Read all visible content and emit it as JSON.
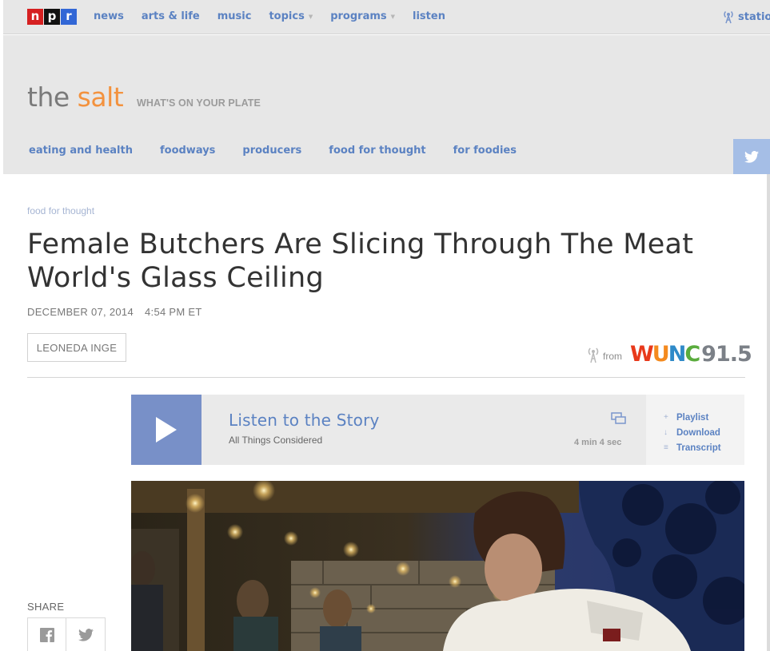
{
  "topnav": {
    "logo_letters": [
      "n",
      "p",
      "r"
    ],
    "links": [
      {
        "label": "news",
        "has_dropdown": false
      },
      {
        "label": "arts & life",
        "has_dropdown": false
      },
      {
        "label": "music",
        "has_dropdown": false
      },
      {
        "label": "topics",
        "has_dropdown": true
      },
      {
        "label": "programs",
        "has_dropdown": true
      },
      {
        "label": "listen",
        "has_dropdown": false
      }
    ],
    "stations_label": "statio",
    "stations_icon": "radio-tower-icon"
  },
  "blog": {
    "name_prefix": "the",
    "name_highlight": "salt",
    "tagline": "WHAT'S ON YOUR PLATE",
    "nav": [
      "eating and health",
      "foodways",
      "producers",
      "food for thought",
      "for foodies"
    ],
    "social_icon": "twitter-icon"
  },
  "article": {
    "slug": "food for thought",
    "title": "Female Butchers Are Slicing Through The Meat World's Glass Ceiling",
    "date": "DECEMBER 07, 2014",
    "time": "4:54 PM ET",
    "author": "LEONEDA INGE",
    "from_label": "from",
    "station": {
      "w": "W",
      "u": "U",
      "n": "N",
      "c": "C",
      "frequency": "91.5"
    }
  },
  "audio": {
    "title": "Listen to the Story",
    "program": "All Things Considered",
    "duration": "4 min 4 sec",
    "actions": [
      {
        "icon": "+",
        "label": "Playlist"
      },
      {
        "icon": "↓",
        "label": "Download"
      },
      {
        "icon": "≡",
        "label": "Transcript"
      }
    ]
  },
  "share": {
    "label": "SHARE",
    "buttons": [
      "facebook-icon",
      "twitter-icon"
    ]
  },
  "colors": {
    "link_blue": "#5b82c2",
    "salt_orange": "#f3923e",
    "banner_gray": "#e7e7e7",
    "play_blue": "#7890c8"
  }
}
